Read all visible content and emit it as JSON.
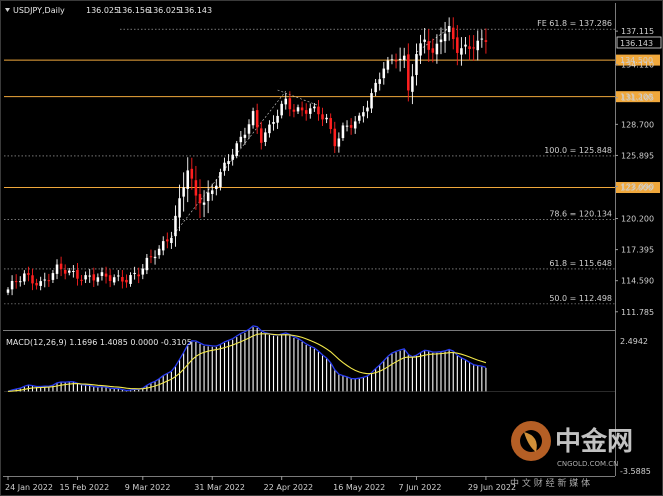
{
  "title": "USDJPY,Daily",
  "ohlc_header": {
    "open": "136.025",
    "high": "136.156",
    "low": "136.025",
    "close": "136.143"
  },
  "current_price_label": "136.143",
  "macd_header": "MACD(12,26,9) 1.1696 1.4085 0.0000 -0.3105",
  "macd_axis": {
    "top": "2.4942",
    "bottom": "-3.5885"
  },
  "watermark": {
    "brand": "中金网",
    "url": "CNGOLD.COM.CN",
    "tagline": "中 文 财 经 新 媒 体"
  },
  "fib_levels": [
    {
      "label": "FE 61.8 = 137.286",
      "price": 137.286
    },
    {
      "label": "100.0 = 125.848",
      "price": 125.848
    },
    {
      "label": "78.6 = 120.134",
      "price": 120.134
    },
    {
      "label": "61.8 = 115.648",
      "price": 115.648
    },
    {
      "label": "50.0 = 112.498",
      "price": 112.498
    }
  ],
  "horizontal_levels": [
    {
      "label": "134.500",
      "price": 134.5
    },
    {
      "label": "131.200",
      "price": 131.2
    },
    {
      "label": "123.000",
      "price": 123.0
    }
  ],
  "chart_data": {
    "type": "candlestick",
    "symbol": "USDJPY",
    "timeframe": "Daily",
    "ylim": [
      110.5,
      138.3
    ],
    "y_tick_labels": [
      "137.115",
      "134.110",
      "131.105",
      "128.700",
      "125.895",
      "123.090",
      "120.200",
      "117.395",
      "114.590",
      "111.785"
    ],
    "x_tick_labels": [
      "24 Jan 2022",
      "15 Feb 2022",
      "9 Mar 2022",
      "31 Mar 2022",
      "22 Apr 2022",
      "16 May 2022",
      "7 Jun 2022",
      "29 Jun 2022"
    ],
    "candle_count": 118,
    "close_anchors": [
      [
        0,
        113.8
      ],
      [
        4,
        114.9
      ],
      [
        8,
        114.5
      ],
      [
        12,
        115.5
      ],
      [
        16,
        115.2
      ],
      [
        20,
        115.0
      ],
      [
        24,
        114.7
      ],
      [
        28,
        114.9
      ],
      [
        32,
        115.2
      ],
      [
        35,
        116.5
      ],
      [
        40,
        119.0
      ],
      [
        44,
        124.5
      ],
      [
        46,
        122.0
      ],
      [
        48,
        121.8
      ],
      [
        52,
        124.3
      ],
      [
        56,
        126.5
      ],
      [
        60,
        129.8
      ],
      [
        62,
        127.5
      ],
      [
        64,
        128.2
      ],
      [
        68,
        130.8
      ],
      [
        70,
        130.2
      ],
      [
        74,
        130.0
      ],
      [
        78,
        129.0
      ],
      [
        80,
        127.2
      ],
      [
        82,
        128.5
      ],
      [
        84,
        128.7
      ],
      [
        86,
        128.9
      ],
      [
        88,
        130.4
      ],
      [
        92,
        134.2
      ],
      [
        95,
        134.6
      ],
      [
        97,
        134.3
      ],
      [
        98,
        131.6
      ],
      [
        100,
        135.0
      ],
      [
        102,
        136.8
      ],
      [
        104,
        135.0
      ],
      [
        106,
        136.5
      ],
      [
        108,
        137.0
      ],
      [
        110,
        135.5
      ],
      [
        112,
        135.8
      ],
      [
        114,
        136.0
      ],
      [
        117,
        136.143
      ]
    ],
    "macd": {
      "axis_range": [
        -3.5885,
        2.4942
      ],
      "values": [
        1.1696,
        1.4085,
        0.0,
        -0.3105
      ]
    }
  }
}
